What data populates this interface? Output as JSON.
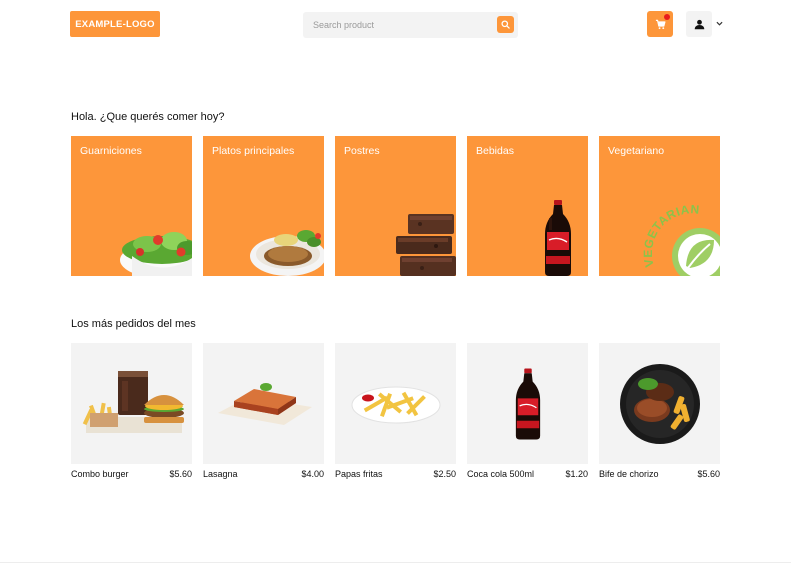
{
  "header": {
    "logo": "EXAMPLE-LOGO",
    "search_placeholder": "Search product"
  },
  "colors": {
    "accent": "#fd963a",
    "badge": "#e81c1c",
    "surface": "#f3f3f3"
  },
  "categories_section": {
    "title": "Hola. ¿Que querés comer hoy?",
    "items": [
      {
        "label": "Guarniciones",
        "icon": "salad-bowl"
      },
      {
        "label": "Platos principales",
        "icon": "meat-plate"
      },
      {
        "label": "Postres",
        "icon": "brownie-stack"
      },
      {
        "label": "Bebidas",
        "icon": "cola-bottle"
      },
      {
        "label": "Vegetariano",
        "icon": "vegetarian-seal",
        "seal_text": "VEGETARIAN"
      }
    ]
  },
  "popular_section": {
    "title": "Los más pedidos del mes",
    "products": [
      {
        "name": "Combo burger",
        "price": "$5.60",
        "icon": "burger-combo"
      },
      {
        "name": "Lasagna",
        "price": "$4.00",
        "icon": "lasagna-plate"
      },
      {
        "name": "Papas fritas",
        "price": "$2.50",
        "icon": "fries-plate"
      },
      {
        "name": "Coca cola 500ml",
        "price": "$1.20",
        "icon": "cola-bottle"
      },
      {
        "name": "Bife de chorizo",
        "price": "$5.60",
        "icon": "steak-plate"
      }
    ]
  }
}
